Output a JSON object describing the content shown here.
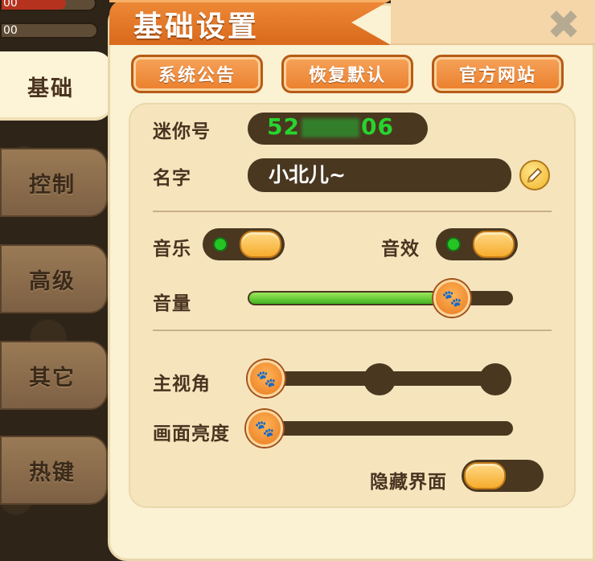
{
  "hud": {
    "bar1_text": "00",
    "bar2_text": "00",
    "bar1_fill_fraction": 0.67
  },
  "title": "基础设置",
  "tabs": [
    {
      "label": "基础",
      "active": true
    },
    {
      "label": "控制",
      "active": false
    },
    {
      "label": "高级",
      "active": false
    },
    {
      "label": "其它",
      "active": false
    },
    {
      "label": "热键",
      "active": false
    }
  ],
  "buttons": {
    "announcement": "系统公告",
    "restore_default": "恢复默认",
    "official_site": "官方网站"
  },
  "account": {
    "mini_id_label": "迷你号",
    "mini_id_prefix": "52",
    "mini_id_suffix": "06",
    "name_label": "名字",
    "name_value": "小北儿~"
  },
  "audio": {
    "music_label": "音乐",
    "music_on": true,
    "sfx_label": "音效",
    "sfx_on": true,
    "volume_label": "音量",
    "volume_fraction": 0.77
  },
  "display": {
    "view_label": "主视角",
    "view_options_count": 3,
    "view_selected_index": 0,
    "brightness_label": "画面亮度",
    "brightness_fraction": 0.0,
    "hide_ui_label": "隐藏界面",
    "hide_ui_on": false
  },
  "colors": {
    "accent_orange": "#ea7f2c",
    "panel_bg": "#fbf1d3",
    "track_brown": "#4a3720",
    "id_green": "#27d42e"
  },
  "icons": {
    "close": "close-x-icon",
    "edit": "pencil-icon",
    "knob": "paw-icon"
  }
}
